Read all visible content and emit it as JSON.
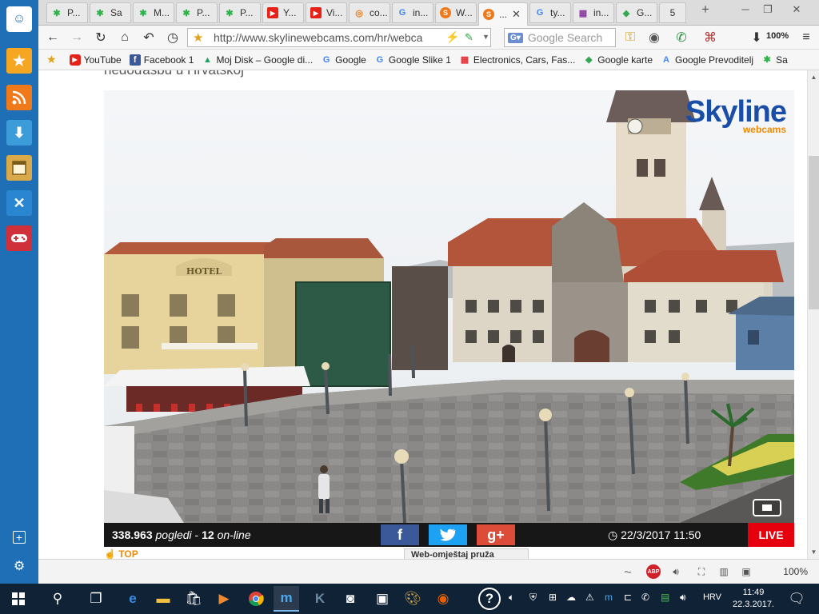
{
  "tabs": [
    {
      "label": "P...",
      "icon": "green-puzzle-icon",
      "active": false
    },
    {
      "label": "Sa",
      "icon": "green-puzzle-icon",
      "active": false
    },
    {
      "label": "M...",
      "icon": "green-puzzle-icon",
      "active": false
    },
    {
      "label": "P...",
      "icon": "green-puzzle-icon",
      "active": false
    },
    {
      "label": "P...",
      "icon": "green-puzzle-icon",
      "active": false
    },
    {
      "label": "Y...",
      "icon": "youtube-icon",
      "active": false
    },
    {
      "label": "Vi...",
      "icon": "youtube-icon",
      "active": false
    },
    {
      "label": "co...",
      "icon": "orange-swirl-icon",
      "active": false
    },
    {
      "label": "in...",
      "icon": "google-icon",
      "active": false
    },
    {
      "label": "W...",
      "icon": "skyline-icon",
      "active": false
    },
    {
      "label": "...",
      "icon": "skyline-icon",
      "active": true
    },
    {
      "label": "ty...",
      "icon": "google-icon",
      "active": false
    },
    {
      "label": "in...",
      "icon": "store-icon",
      "active": false
    },
    {
      "label": "G...",
      "icon": "maps-icon",
      "active": false
    }
  ],
  "tab_overflow_count": "5",
  "new_tab_symbol": "+",
  "url": "http://www.skylinewebcams.com/hr/webca",
  "search_placeholder": "Google Search",
  "toolbar_zoom": "100%",
  "bookmarks": [
    {
      "label": "YouTube",
      "icon": "youtube-icon",
      "color": "#e62117"
    },
    {
      "label": "Facebook 1",
      "icon": "facebook-icon",
      "color": "#3b5998"
    },
    {
      "label": "Moj Disk – Google di...",
      "icon": "google-drive-icon",
      "color": "#1da462"
    },
    {
      "label": "Google",
      "icon": "google-icon",
      "color": "#4285f4"
    },
    {
      "label": "Google Slike 1",
      "icon": "google-icon",
      "color": "#4285f4"
    },
    {
      "label": "Electronics, Cars, Fas...",
      "icon": "ebay-icon",
      "color": "#e53238"
    },
    {
      "label": "Google karte",
      "icon": "google-maps-icon",
      "color": "#34a853"
    },
    {
      "label": "Google Prevoditelj",
      "icon": "google-translate-icon",
      "color": "#4285f4"
    },
    {
      "label": "Sa",
      "icon": "green-puzzle-icon",
      "color": "#2fb34a"
    }
  ],
  "page": {
    "heading_cut": "nedoďasbu u Hrvatskoj",
    "logo_main": "Skyline",
    "logo_sub": "webcams",
    "hotel_sign": "HOTEL",
    "views_count": "338.963",
    "views_label": "pogledi",
    "online_count": "12",
    "online_label": "on-line",
    "facebook_glyph": "f",
    "google_plus_glyph": "g+",
    "datetime": "22/3/2017 11:50",
    "live_label": "LIVE",
    "top_link": "TOP",
    "partial_button": "Web-omještaj pruža"
  },
  "status_zoom": "100%",
  "taskbar": {
    "lang": "HRV",
    "time": "11:49",
    "date": "22.3.2017."
  },
  "colors": {
    "sidebar": "#1e6fb5",
    "live": "#e6000e",
    "facebook": "#3b5998",
    "twitter": "#1da1f2",
    "google_plus": "#dd4b39",
    "taskbar": "#0f2236",
    "logo_blue": "#1a4ea6",
    "logo_orange": "#f28a00"
  }
}
